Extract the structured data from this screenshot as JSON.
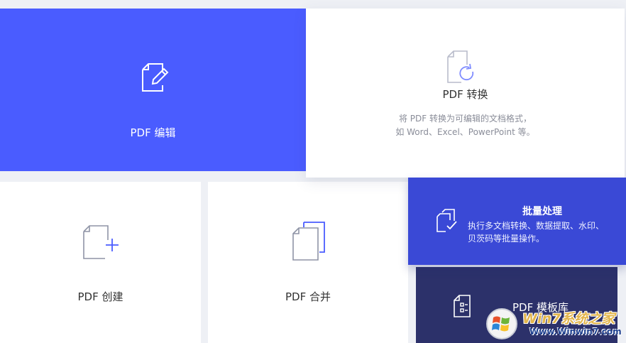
{
  "cards": {
    "edit": {
      "title": "PDF 编辑",
      "icon": "edit-document-icon"
    },
    "convert": {
      "title": "PDF 转换",
      "desc_line1": "将 PDF 转换为可编辑的文档格式，",
      "desc_line2": "如 Word、Excel、PowerPoint 等。",
      "icon": "convert-document-icon"
    },
    "create": {
      "title": "PDF 创建",
      "icon": "create-document-icon"
    },
    "merge": {
      "title": "PDF 合并",
      "icon": "merge-documents-icon"
    },
    "batch": {
      "title": "批量处理",
      "desc_line1": "执行多文档转换、数据提取、水印、",
      "desc_line2": "贝茨码等批量操作。",
      "icon": "batch-documents-icon"
    },
    "template": {
      "title": "PDF 模板库",
      "icon": "template-document-icon"
    }
  },
  "watermark": {
    "title": "Win7系统之家",
    "url": "Www.Winwin7.com"
  },
  "colors": {
    "edit_bg": "#4a5cff",
    "batch_bg": "#3a49d6",
    "template_bg": "#2c316a",
    "icon_gray": "#9aa0b4",
    "accent_blue": "#4a5cff"
  }
}
